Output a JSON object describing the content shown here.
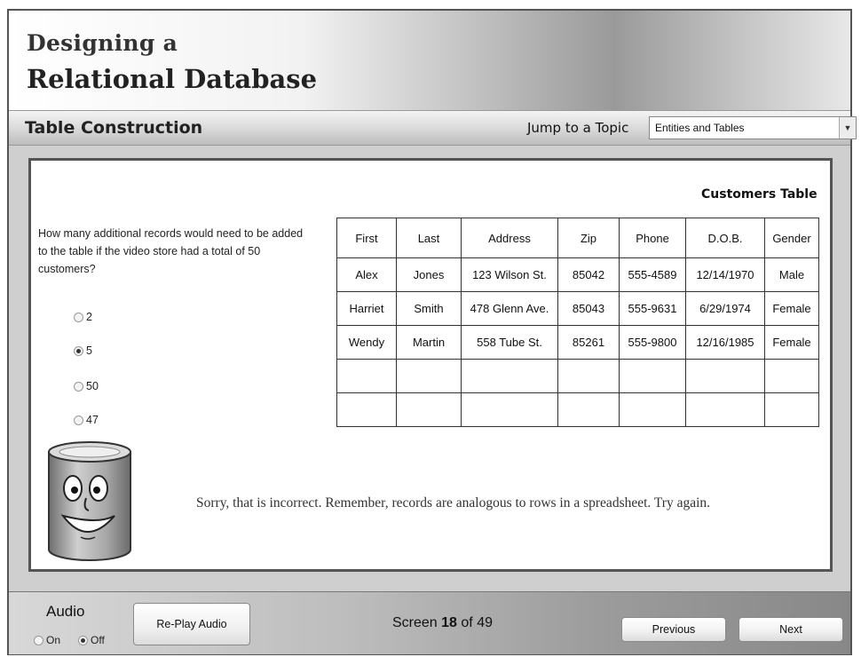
{
  "header": {
    "title_line1": "Designing a",
    "title_line2": "Relational Database"
  },
  "topic_bar": {
    "section_title": "Table Construction",
    "jump_label": "Jump to a Topic",
    "topic_selected": "Entities and Tables"
  },
  "question": {
    "text": "How many additional records would need to be added to the table if the video store had a total of 50 customers?",
    "options": [
      {
        "label": "2",
        "selected": false
      },
      {
        "label": "5",
        "selected": true
      },
      {
        "label": "50",
        "selected": false
      },
      {
        "label": "47",
        "selected": false
      }
    ]
  },
  "table": {
    "title": "Customers Table",
    "columns": [
      "First",
      "Last",
      "Address",
      "Zip",
      "Phone",
      "D.O.B.",
      "Gender"
    ],
    "rows": [
      [
        "Alex",
        "Jones",
        "123 Wilson St.",
        "85042",
        "555-4589",
        "12/14/1970",
        "Male"
      ],
      [
        "Harriet",
        "Smith",
        "478 Glenn Ave.",
        "85043",
        "555-9631",
        "6/29/1974",
        "Female"
      ],
      [
        "Wendy",
        "Martin",
        "558 Tube St.",
        "85261",
        "555-9800",
        "12/16/1985",
        "Female"
      ],
      [
        "",
        "",
        "",
        "",
        "",
        "",
        ""
      ],
      [
        "",
        "",
        "",
        "",
        "",
        "",
        ""
      ]
    ]
  },
  "feedback": {
    "text": "Sorry, that is incorrect.  Remember, records are analogous to rows in a spreadsheet.  Try again."
  },
  "footer": {
    "audio_label": "Audio",
    "audio_on": "On",
    "audio_off": "Off",
    "audio_selected": "Off",
    "replay_label": "Re-Play Audio",
    "screen_prefix": "Screen",
    "screen_current": "18",
    "screen_of": "of",
    "screen_total": "49",
    "previous_label": "Previous",
    "next_label": "Next"
  }
}
